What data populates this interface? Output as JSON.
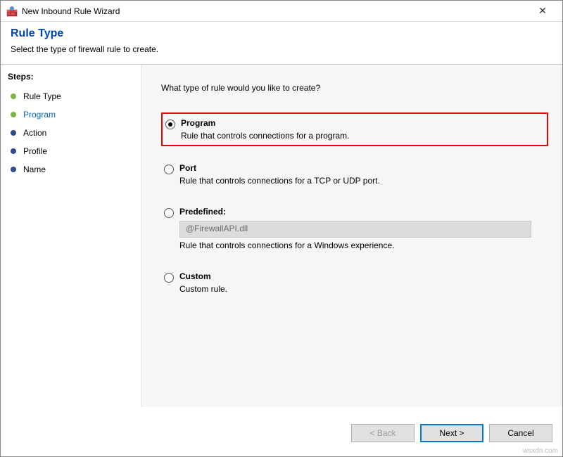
{
  "window": {
    "title": "New Inbound Rule Wizard"
  },
  "header": {
    "title": "Rule Type",
    "subtitle": "Select the type of firewall rule to create."
  },
  "sidebar": {
    "title": "Steps:",
    "items": [
      {
        "label": "Rule Type",
        "state": "done"
      },
      {
        "label": "Program",
        "state": "active"
      },
      {
        "label": "Action",
        "state": "pending"
      },
      {
        "label": "Profile",
        "state": "pending"
      },
      {
        "label": "Name",
        "state": "pending"
      }
    ]
  },
  "content": {
    "prompt": "What type of rule would you like to create?",
    "options": [
      {
        "key": "program",
        "label": "Program",
        "desc": "Rule that controls connections for a program.",
        "selected": true,
        "highlighted": true
      },
      {
        "key": "port",
        "label": "Port",
        "desc": "Rule that controls connections for a TCP or UDP port.",
        "selected": false
      },
      {
        "key": "predefined",
        "label": "Predefined:",
        "desc": "Rule that controls connections for a Windows experience.",
        "selected": false,
        "dropdown": "@FirewallAPI.dll"
      },
      {
        "key": "custom",
        "label": "Custom",
        "desc": "Custom rule.",
        "selected": false
      }
    ]
  },
  "footer": {
    "back": "< Back",
    "next": "Next >",
    "cancel": "Cancel"
  },
  "watermark": "wsxdn.com"
}
